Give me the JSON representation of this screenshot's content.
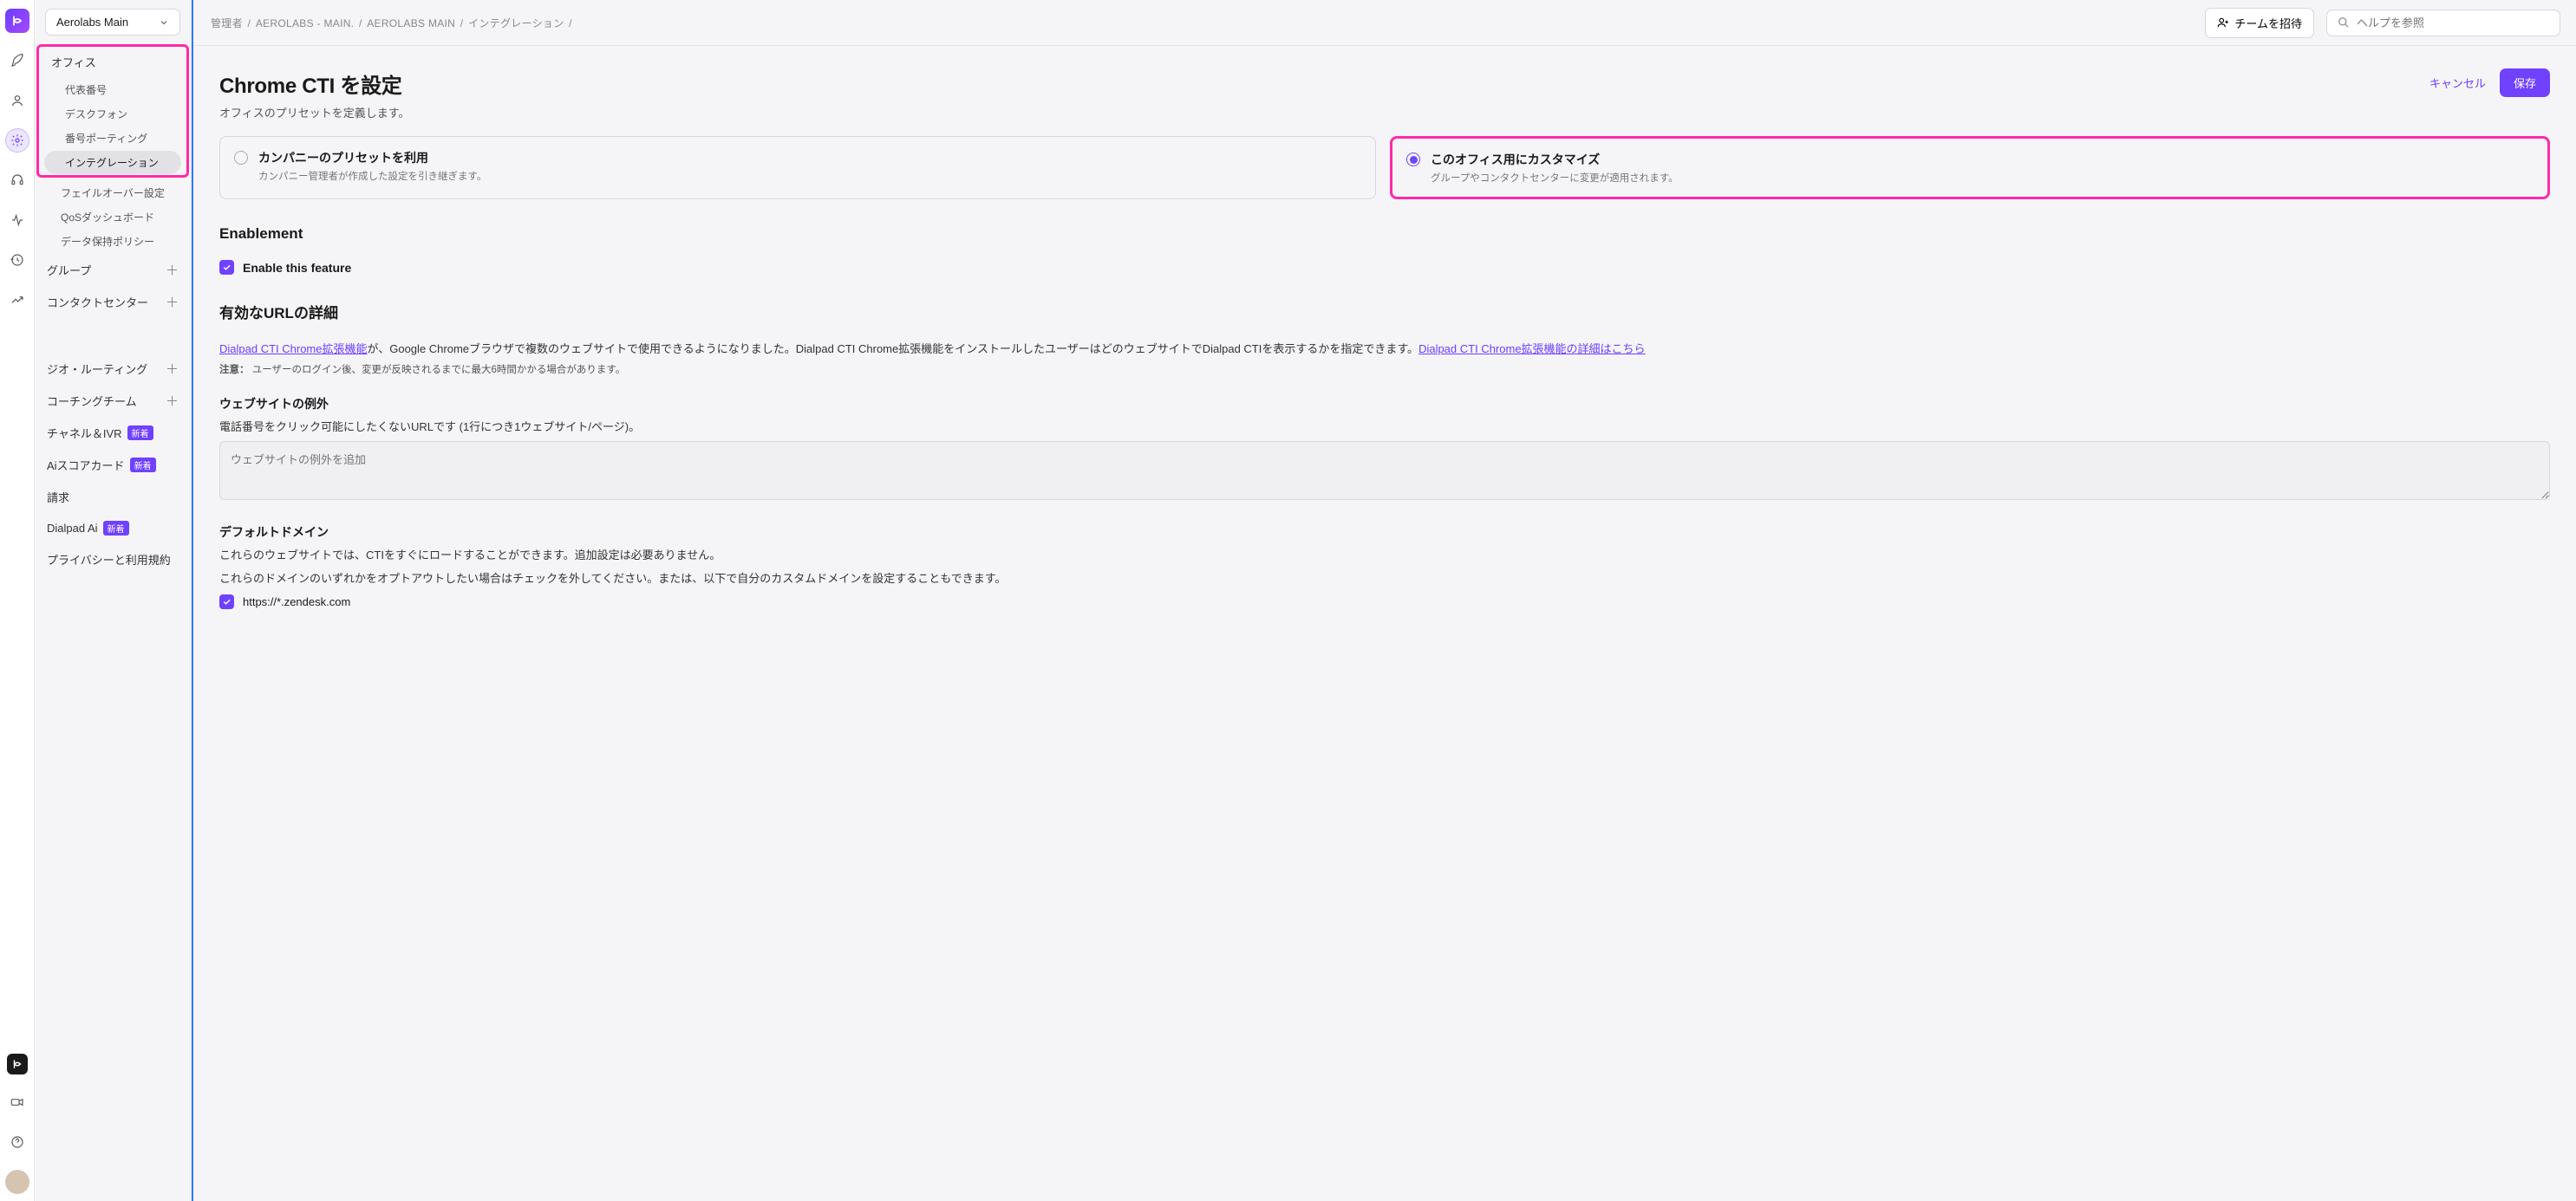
{
  "workspace": {
    "name": "Aerolabs Main"
  },
  "breadcrumb": [
    "管理者",
    "AEROLABS - MAIN.",
    "AEROLABS MAIN",
    "インテグレーション"
  ],
  "topbar": {
    "invite_label": "チームを招待",
    "search_placeholder": "ヘルプを参照"
  },
  "sidebar": {
    "office_label": "オフィス",
    "office_items": [
      "代表番号",
      "デスクフォン",
      "番号ポーティング",
      "インテグレーション",
      "フェイルオーバー設定",
      "QoSダッシュボード",
      "データ保持ポリシー"
    ],
    "group_label": "グループ",
    "cc_label": "コンタクトセンター",
    "geo_label": "ジオ・ルーティング",
    "coaching_label": "コーチングチーム",
    "channel_label": "チャネル＆IVR",
    "scorecard_label": "Aiスコアカード",
    "billing_label": "請求",
    "dialpad_ai_label": "Dialpad Ai",
    "privacy_label": "プライバシーと利用規約",
    "tag_new": "新着"
  },
  "page": {
    "title": "Chrome CTI を設定",
    "subtitle": "オフィスのプリセットを定義します。",
    "cancel": "キャンセル",
    "save": "保存"
  },
  "presets": {
    "company": {
      "title": "カンパニーのプリセットを利用",
      "desc": "カンパニー管理者が作成した設定を引き継ぎます。"
    },
    "office": {
      "title": "このオフィス用にカスタマイズ",
      "desc": "グループやコンタクトセンターに変更が適用されます。"
    }
  },
  "enablement": {
    "heading": "Enablement",
    "checkbox_label": "Enable this feature"
  },
  "valid_urls": {
    "heading": "有効なURLの詳細",
    "link1": "Dialpad CTI Chrome拡張機能",
    "text1_mid": "が、Google Chromeブラウザで複数のウェブサイトで使用できるようになりました。Dialpad CTI Chrome拡張機能をインストールしたユーザーはどのウェブサイトでDialpad CTIを表示するかを指定できます。",
    "link2": "Dialpad CTI Chrome拡張機能の詳細はこちら",
    "note_label": "注意：",
    "note_text": "ユーザーのログイン後、変更が反映されるまでに最大6時間かかる場合があります。"
  },
  "exceptions": {
    "heading": "ウェブサイトの例外",
    "desc": "電話番号をクリック可能にしたくないURLです (1行につき1ウェブサイト/ページ)。",
    "placeholder": "ウェブサイトの例外を追加"
  },
  "default_domain": {
    "heading": "デフォルトドメイン",
    "line1": "これらのウェブサイトでは、CTIをすぐにロードすることができます。追加設定は必要ありません。",
    "line2": "これらのドメインのいずれかをオプトアウトしたい場合はチェックを外してください。または、以下で自分のカスタムドメインを設定することもできます。",
    "item1": "https://*.zendesk.com"
  }
}
